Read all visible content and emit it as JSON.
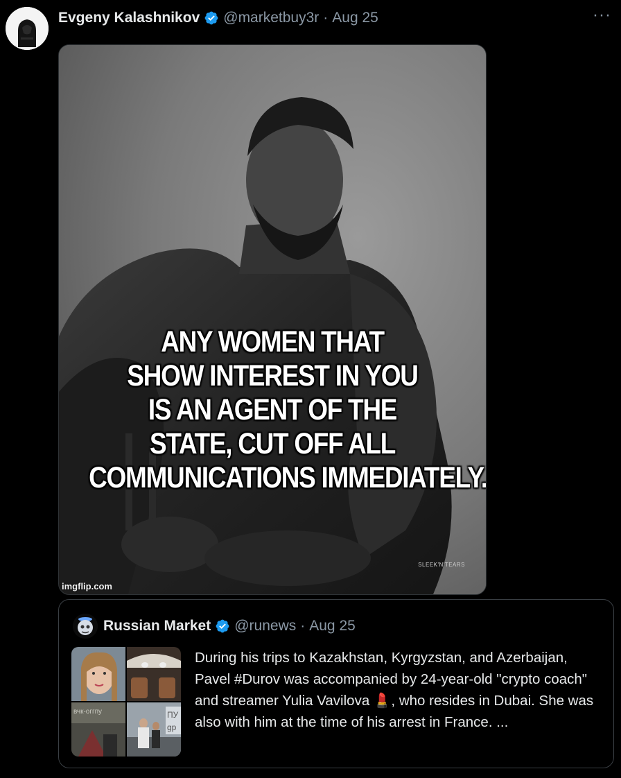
{
  "tweet": {
    "author_name": "Evgeny Kalashnikov",
    "author_handle": "@marketbuy3r",
    "separator": "·",
    "date": "Aug 25",
    "more_label": "···",
    "image": {
      "caption_lines": [
        "ANY WOMEN THAT",
        "SHOW INTEREST IN YOU",
        "IS AN AGENT OF THE",
        "STATE, CUT OFF ALL",
        "COMMUNICATIONS IMMEDIATELY."
      ],
      "watermark": "imgflip.com",
      "signature": "SLEEK'N'TEARS"
    }
  },
  "quote": {
    "author_name": "Russian Market",
    "author_handle": "@runews",
    "separator": "·",
    "date": "Aug 25",
    "text": "During his trips to Kazakhstan, Kyrgyzstan, and Azerbaijan, Pavel #Durov was accompanied by 24-year-old \"crypto coach\" and streamer Yulia Vavilova 💄, who resides in Dubai. She was also with him at the time of his arrest in France. ...",
    "thumb_texts": [
      "вчк-оггпу",
      "ПУ",
      "gp"
    ]
  },
  "colors": {
    "background": "#000000",
    "text": "#e7e9ea",
    "muted": "#8b98a5",
    "verified": "#1d9bf0",
    "border": "#3a3f44"
  }
}
